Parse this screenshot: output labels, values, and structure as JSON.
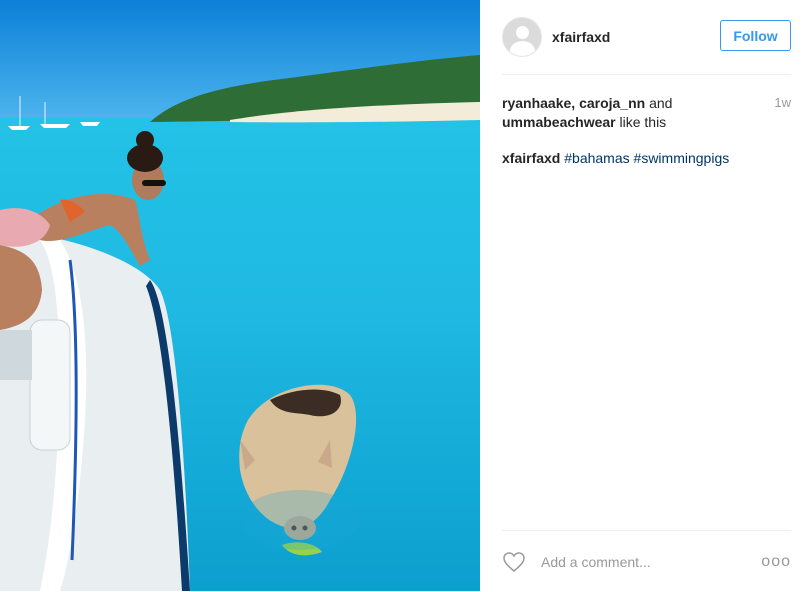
{
  "header": {
    "username": "xfairfaxd",
    "follow_label": "Follow"
  },
  "likes": {
    "user1": "ryanhaake",
    "sep1": ", ",
    "user2": "caroja_nn",
    "and": " and ",
    "user3": "ummabeachwear",
    "suffix": " like this"
  },
  "time": "1w",
  "caption": {
    "author": "xfairfaxd",
    "tag1": "#bahamas",
    "tag2": "#swimmingpigs"
  },
  "footer": {
    "comment_placeholder": "Add a comment...",
    "more_label": "ooo",
    "like_icon": "heart-icon",
    "more_icon": "more-options-icon"
  },
  "colors": {
    "accent": "#3897f0",
    "hashtag": "#003569"
  }
}
